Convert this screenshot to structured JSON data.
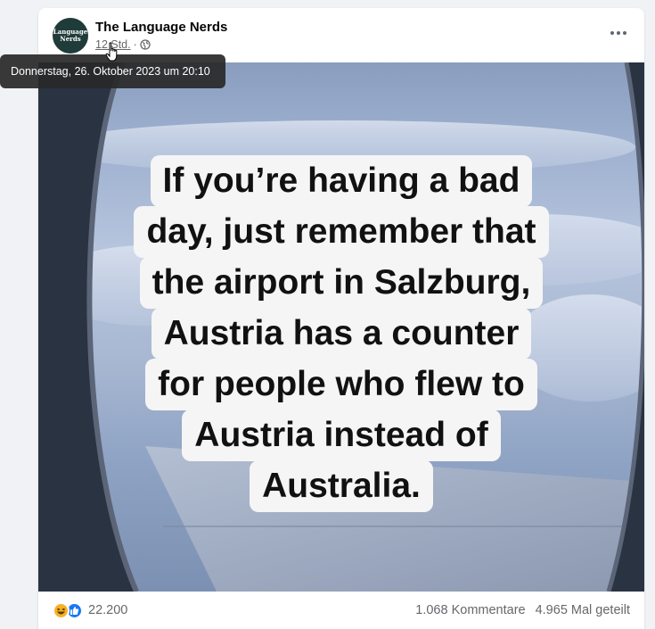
{
  "post": {
    "page_name": "The Language Nerds",
    "avatar_text_line1": "Language",
    "avatar_text_line2": "Nerds",
    "time": "12 Std.",
    "separator": "·",
    "tooltip": "Donnerstag, 26. Oktober 2023 um 20:10"
  },
  "image": {
    "lines": [
      "If you’re having a bad",
      "day, just remember that",
      "the airport in Salzburg,",
      "Austria has a counter",
      "for people who flew to",
      "Austria instead of",
      "Australia."
    ]
  },
  "stats": {
    "reactions_count": "22.200",
    "comments": "1.068 Kommentare",
    "shares": "4.965 Mal geteilt"
  },
  "icons": {
    "privacy": "globe-icon",
    "menu": "more-icon",
    "reaction1": "haha-icon",
    "reaction2": "like-icon"
  },
  "colors": {
    "like_blue": "#1877f2",
    "haha_yellow": "#f7b125",
    "meta_gray": "#65676b"
  }
}
